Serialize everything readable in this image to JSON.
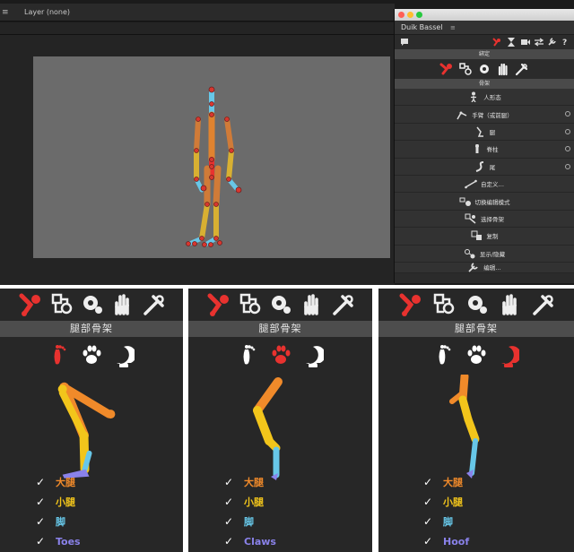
{
  "comp": {
    "menu_icon": "≡",
    "layer_label": "Layer (none)"
  },
  "duik": {
    "window_dots": [
      "#ff5f56",
      "#ffbd2e",
      "#27c93f"
    ],
    "tab_title": "Duik Bassel",
    "tab_menu_icon": "≡",
    "section_bind": "綁定",
    "section_bones": "骨架",
    "items": [
      {
        "label": "人形态",
        "icon": "human-icon",
        "radio": false
      },
      {
        "label": "手臂（或前腿）",
        "icon": "arm-icon",
        "radio": true
      },
      {
        "label": "腿",
        "icon": "leg-icon",
        "radio": true
      },
      {
        "label": "脊柱",
        "icon": "spine-icon",
        "radio": true
      },
      {
        "label": "尾",
        "icon": "tail-icon",
        "radio": true
      },
      {
        "label": "自定义…",
        "icon": "custom-bone-icon",
        "radio": false
      },
      {
        "label": "切换编辑模式",
        "icon": "edit-mode-icon",
        "radio": false
      },
      {
        "label": "选择骨架",
        "icon": "select-bones-icon",
        "radio": false
      },
      {
        "label": "复制",
        "icon": "duplicate-icon",
        "radio": false
      },
      {
        "label": "显示/隐藏",
        "icon": "show-hide-icon",
        "radio": false
      },
      {
        "label": "编辑…",
        "icon": "wrench-icon",
        "radio": false
      }
    ]
  },
  "panels": [
    {
      "title": "腿部骨架",
      "active_type": "foot",
      "checks": [
        {
          "label": "大腿",
          "color": "#f08a2a"
        },
        {
          "label": "小腿",
          "color": "#f2c51b"
        },
        {
          "label": "脚",
          "color": "#67c7e8"
        },
        {
          "label": "Toes",
          "color": "#8a82ea"
        }
      ]
    },
    {
      "title": "腿部骨架",
      "active_type": "claw",
      "checks": [
        {
          "label": "大腿",
          "color": "#f08a2a"
        },
        {
          "label": "小腿",
          "color": "#f2c51b"
        },
        {
          "label": "脚",
          "color": "#67c7e8"
        },
        {
          "label": "Claws",
          "color": "#8a82ea"
        }
      ]
    },
    {
      "title": "腿部骨架",
      "active_type": "hoof",
      "checks": [
        {
          "label": "大腿",
          "color": "#f08a2a"
        },
        {
          "label": "小腿",
          "color": "#f2c51b"
        },
        {
          "label": "脚",
          "color": "#67c7e8"
        },
        {
          "label": "Hoof",
          "color": "#8a82ea"
        }
      ]
    }
  ],
  "check_mark": "✓",
  "colors": {
    "accent_red": "#e8322f",
    "thigh": "#f08a2a",
    "calf": "#f2c51b",
    "foot": "#67c7e8",
    "toes": "#8a82ea"
  }
}
